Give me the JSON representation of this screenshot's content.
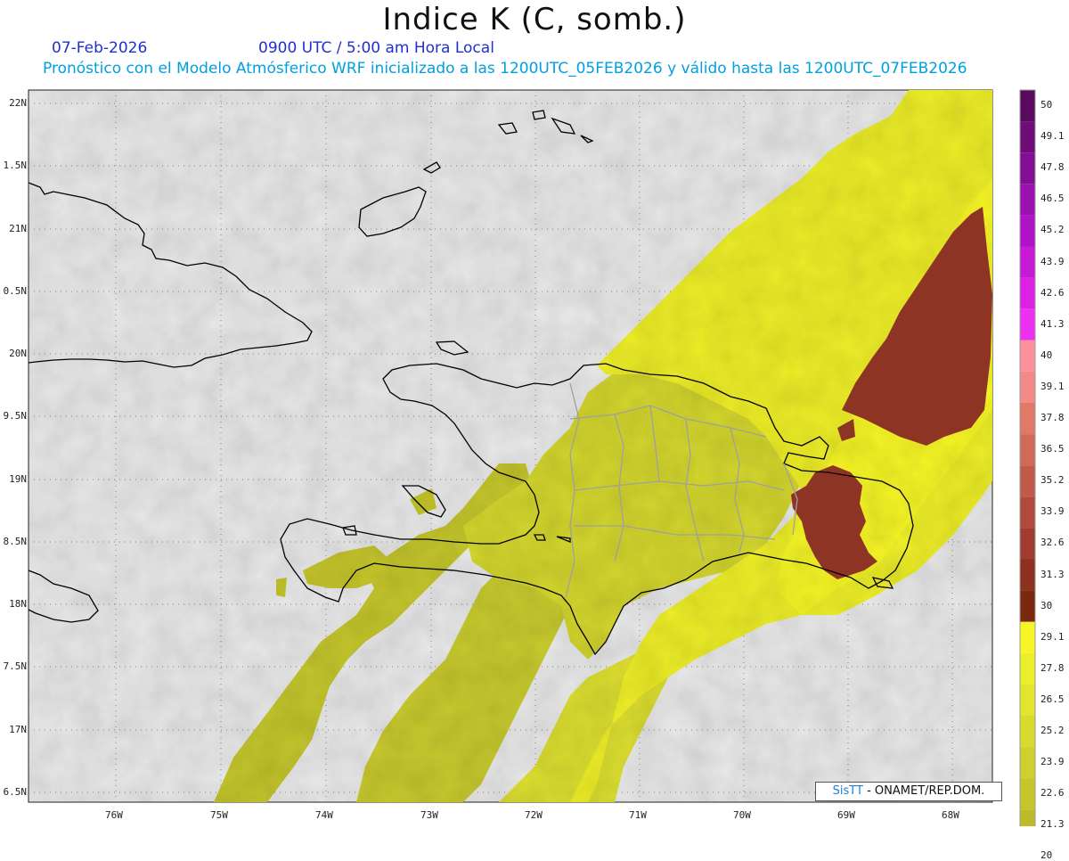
{
  "header": {
    "title": "Indice K (C, somb.)",
    "date": "07-Feb-2026",
    "time": "0900 UTC / 5:00 am Hora Local",
    "description": "Pronóstico con el Modelo Atmósferico WRF inicializado a las 1200UTC_05FEB2026 y válido hasta las  1200UTC_07FEB2026"
  },
  "map": {
    "region": "Hispaniola / Caribbean",
    "background_color": "#e9e9e9",
    "coastline_color": "#000000",
    "province_border_color": "#a0a0a0",
    "lat_labels": [
      "22N",
      "1.5N",
      "21N",
      "0.5N",
      "20N",
      "9.5N",
      "19N",
      "8.5N",
      "18N",
      "7.5N",
      "17N",
      "6.5N"
    ],
    "lon_labels": [
      "76W",
      "75W",
      "74W",
      "73W",
      "72W",
      "71W",
      "70W",
      "69W",
      "68W"
    ]
  },
  "colorbar": {
    "labels": [
      "50",
      "49.1",
      "47.8",
      "46.5",
      "45.2",
      "43.9",
      "42.6",
      "41.3",
      "40",
      "39.1",
      "37.8",
      "36.5",
      "35.2",
      "33.9",
      "32.6",
      "31.3",
      "30",
      "29.1",
      "27.8",
      "26.5",
      "25.2",
      "23.9",
      "22.6",
      "21.3",
      "20"
    ],
    "colors": [
      "#5a0a5e",
      "#6e0c78",
      "#820e94",
      "#9a10b0",
      "#b012c8",
      "#c818d8",
      "#dc20e6",
      "#ee30f0",
      "#ff90a0",
      "#f48a88",
      "#e27866",
      "#d26a58",
      "#c05a4a",
      "#b04a3c",
      "#a03c30",
      "#8e3020",
      "#7a2810",
      "#f6f626",
      "#ecee2a",
      "#e2e42e",
      "#d8da2e",
      "#cfd02e",
      "#c6c62c",
      "#bcbc2a",
      "#e6e6e6"
    ]
  },
  "credit": {
    "brand": "SisTT",
    "text": " - ONAMET/REP.DOM."
  }
}
